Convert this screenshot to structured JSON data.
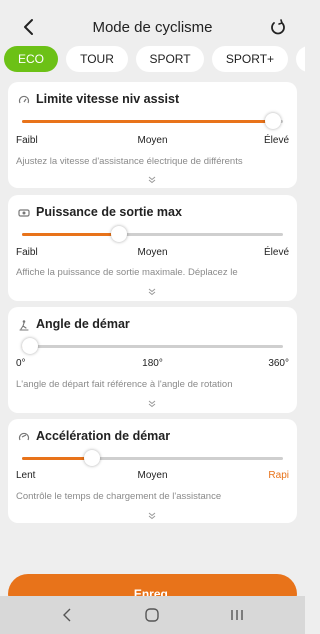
{
  "header": {
    "title": "Mode de cyclisme",
    "back_icon": "chevron-left-icon",
    "reset_icon": "refresh-icon"
  },
  "tabs": [
    {
      "label": "ECO",
      "active": true
    },
    {
      "label": "TOUR",
      "active": false
    },
    {
      "label": "SPORT",
      "active": false
    },
    {
      "label": "SPORT+",
      "active": false
    },
    {
      "label": "",
      "active": false
    }
  ],
  "cards": [
    {
      "title": "Limite vitesse niv assist",
      "icon": "speedometer-icon",
      "slider_value": 0.96,
      "labels": [
        "Faibl",
        "Moyen",
        "Élevé"
      ],
      "desc": "Ajustez la vitesse d'assistance électrique de différents",
      "right_accent": false
    },
    {
      "title": "Puissance de sortie max",
      "icon": "power-output-icon",
      "slider_value": 0.37,
      "labels": [
        "Faibl",
        "Moyen",
        "Élevé"
      ],
      "desc": "Affiche la puissance de sortie maximale. Déplacez le",
      "right_accent": false
    },
    {
      "title": "Angle de démar",
      "icon": "slope-angle-icon",
      "slider_value": 0.03,
      "labels": [
        "0°",
        "180°",
        "360°"
      ],
      "desc": "L'angle de départ fait référence à l'angle de rotation",
      "right_accent": false
    },
    {
      "title": "Accélération de démar",
      "icon": "acceleration-icon",
      "slider_value": 0.27,
      "labels": [
        "Lent",
        "Moyen",
        "Rapi"
      ],
      "desc": "Contrôle le temps de chargement de l'assistance",
      "right_accent": true
    }
  ],
  "save_button": {
    "label": "Enreg."
  },
  "colors": {
    "accent": "#e8731a",
    "active_tab": "#6cc116"
  }
}
